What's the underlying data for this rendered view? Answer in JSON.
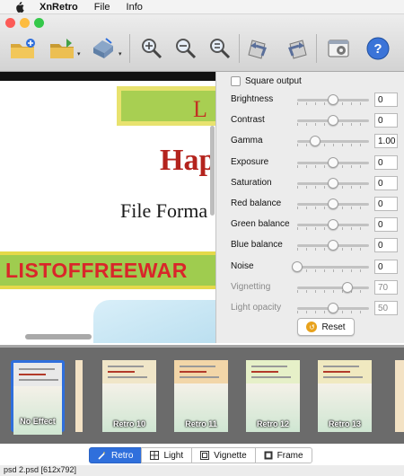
{
  "menubar": {
    "app_name": "XnRetro",
    "menus": [
      "File",
      "Info"
    ]
  },
  "window": {
    "traffic_lights": {
      "close": "#fc5b57",
      "minimize": "#fdbc40",
      "zoom": "#34c84a"
    },
    "toolbar": [
      {
        "icon": "open-folder-icon"
      },
      {
        "icon": "open-recent-icon",
        "dropdown": true
      },
      {
        "icon": "save-icon",
        "dropdown": true
      },
      {
        "icon": "zoom-in-icon"
      },
      {
        "icon": "zoom-out-icon"
      },
      {
        "icon": "zoom-fit-icon"
      },
      {
        "icon": "rotate-left-icon"
      },
      {
        "icon": "rotate-right-icon"
      },
      {
        "icon": "settings-window-icon"
      },
      {
        "icon": "help-icon",
        "text": "?"
      }
    ]
  },
  "preview": {
    "top_banner_text": "L",
    "headline": "Hap",
    "subheadline": "File Forma",
    "banner_text": "LISTOFFREEWAR"
  },
  "adjustments": {
    "square_output": {
      "label": "Square output",
      "checked": false
    },
    "sliders": [
      {
        "label": "Brightness",
        "value": "0",
        "level": 0.5,
        "enabled": true
      },
      {
        "label": "Contrast",
        "value": "0",
        "level": 0.5,
        "enabled": true
      },
      {
        "label": "Gamma",
        "value": "1.00",
        "level": 0.25,
        "enabled": true
      },
      {
        "label": "Exposure",
        "value": "0",
        "level": 0.5,
        "enabled": true
      },
      {
        "label": "Saturation",
        "value": "0",
        "level": 0.5,
        "enabled": true
      },
      {
        "label": "Red balance",
        "value": "0",
        "level": 0.5,
        "enabled": true
      },
      {
        "label": "Green balance",
        "value": "0",
        "level": 0.5,
        "enabled": true
      },
      {
        "label": "Blue balance",
        "value": "0",
        "level": 0.5,
        "enabled": true
      },
      {
        "label": "Noise",
        "value": "0",
        "level": 0.0,
        "enabled": true
      },
      {
        "label": "Vignetting",
        "value": "70",
        "level": 0.7,
        "enabled": false
      },
      {
        "label": "Light opacity",
        "value": "50",
        "level": 0.5,
        "enabled": false
      }
    ],
    "reset_label": "Reset"
  },
  "filmstrip": {
    "effects": [
      {
        "label": "No Effect",
        "selected": true,
        "header_color": "#e9e9e9"
      },
      {
        "label": "Retro 10",
        "selected": false,
        "header_color": "#f0e6c8"
      },
      {
        "label": "Retro 11",
        "selected": false,
        "header_color": "#f2d6a8"
      },
      {
        "label": "Retro 12",
        "selected": false,
        "header_color": "#e6f0c8"
      },
      {
        "label": "Retro 13",
        "selected": false,
        "header_color": "#f0e9c0"
      }
    ]
  },
  "modes": [
    {
      "label": "Retro",
      "icon": "retro-wand-icon",
      "selected": true
    },
    {
      "label": "Light",
      "icon": "light-icon",
      "selected": false
    },
    {
      "label": "Vignette",
      "icon": "vignette-icon",
      "selected": false
    },
    {
      "label": "Frame",
      "icon": "frame-icon",
      "selected": false
    }
  ],
  "status": {
    "text": "psd 2.psd [612x792]"
  }
}
